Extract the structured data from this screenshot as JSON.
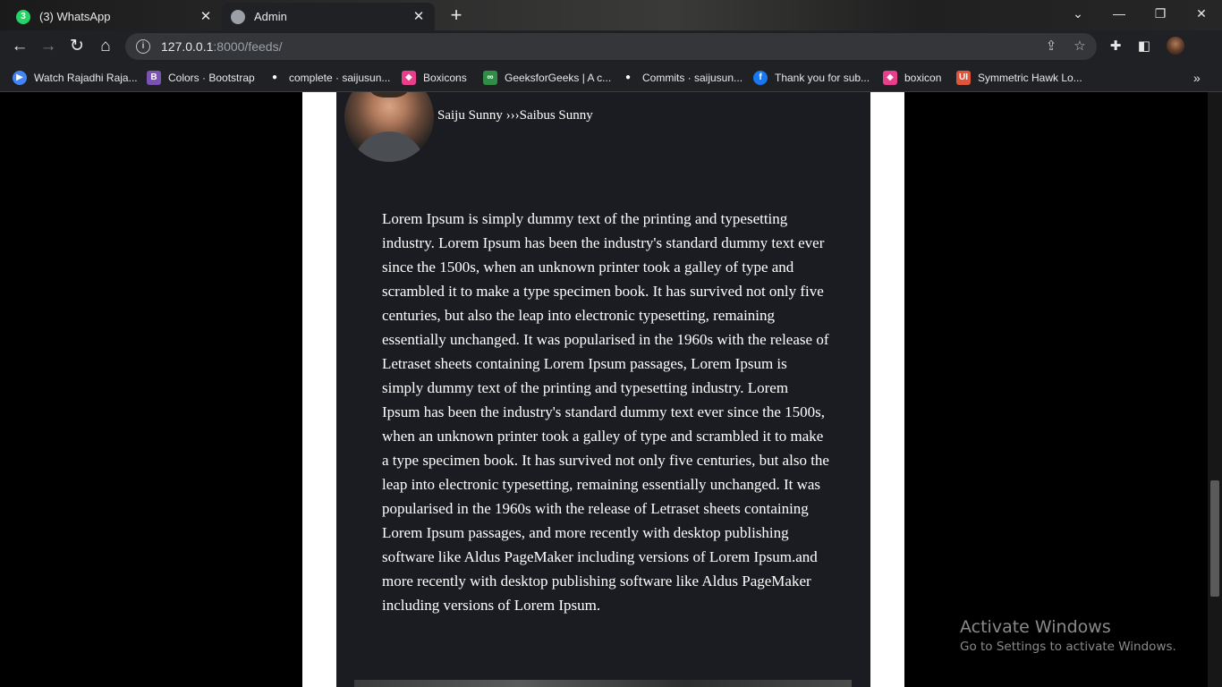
{
  "tabs": [
    {
      "label": "(3) WhatsApp",
      "badge": "3"
    },
    {
      "label": "Admin"
    }
  ],
  "toolbar": {
    "url_host": "127.0.0.1",
    "url_rest": ":8000/feeds/"
  },
  "bookmarks": [
    {
      "label": "Watch Rajadhi Raja...",
      "icon": "play-icon",
      "color": "#4285f4"
    },
    {
      "label": "Colors · Bootstrap",
      "icon": "bootstrap-icon",
      "color": "#7952b3"
    },
    {
      "label": "complete · saijusun...",
      "icon": "github-icon",
      "color": "#ffffff"
    },
    {
      "label": "Boxicons",
      "icon": "boxicons-icon",
      "color": "#e83e8c"
    },
    {
      "label": "GeeksforGeeks | A c...",
      "icon": "gfg-icon",
      "color": "#2f8d46"
    },
    {
      "label": "Commits · saijusun...",
      "icon": "github-icon",
      "color": "#ffffff"
    },
    {
      "label": "Thank you for sub...",
      "icon": "facebook-icon",
      "color": "#1877f2"
    },
    {
      "label": "boxicon",
      "icon": "boxicons-icon",
      "color": "#e83e8c"
    },
    {
      "label": "Symmetric Hawk Lo...",
      "icon": "ui-icon",
      "color": "#e0553a"
    }
  ],
  "feed": {
    "author": "Saiju Sunny ›››Saibus Sunny",
    "body": "Lorem Ipsum is simply dummy text of the printing and typesetting industry. Lorem Ipsum has been the industry's standard dummy text ever since the 1500s, when an unknown printer took a galley of type and scrambled it to make a type specimen book. It has survived not only five centuries, but also the leap into electronic typesetting, remaining essentially unchanged. It was popularised in the 1960s with the release of Letraset sheets containing Lorem Ipsum passages, Lorem Ipsum is simply dummy text of the printing and typesetting industry. Lorem Ipsum has been the industry's standard dummy text ever since the 1500s, when an unknown printer took a galley of type and scrambled it to make a type specimen book. It has survived not only five centuries, but also the leap into electronic typesetting, remaining essentially unchanged. It was popularised in the 1960s with the release of Letraset sheets containing Lorem Ipsum passages, and more recently with desktop publishing software like Aldus PageMaker including versions of Lorem Ipsum.and more recently with desktop publishing software like Aldus PageMaker including versions of Lorem Ipsum."
  },
  "watermark": {
    "title": "Activate Windows",
    "subtitle": "Go to Settings to activate Windows."
  }
}
